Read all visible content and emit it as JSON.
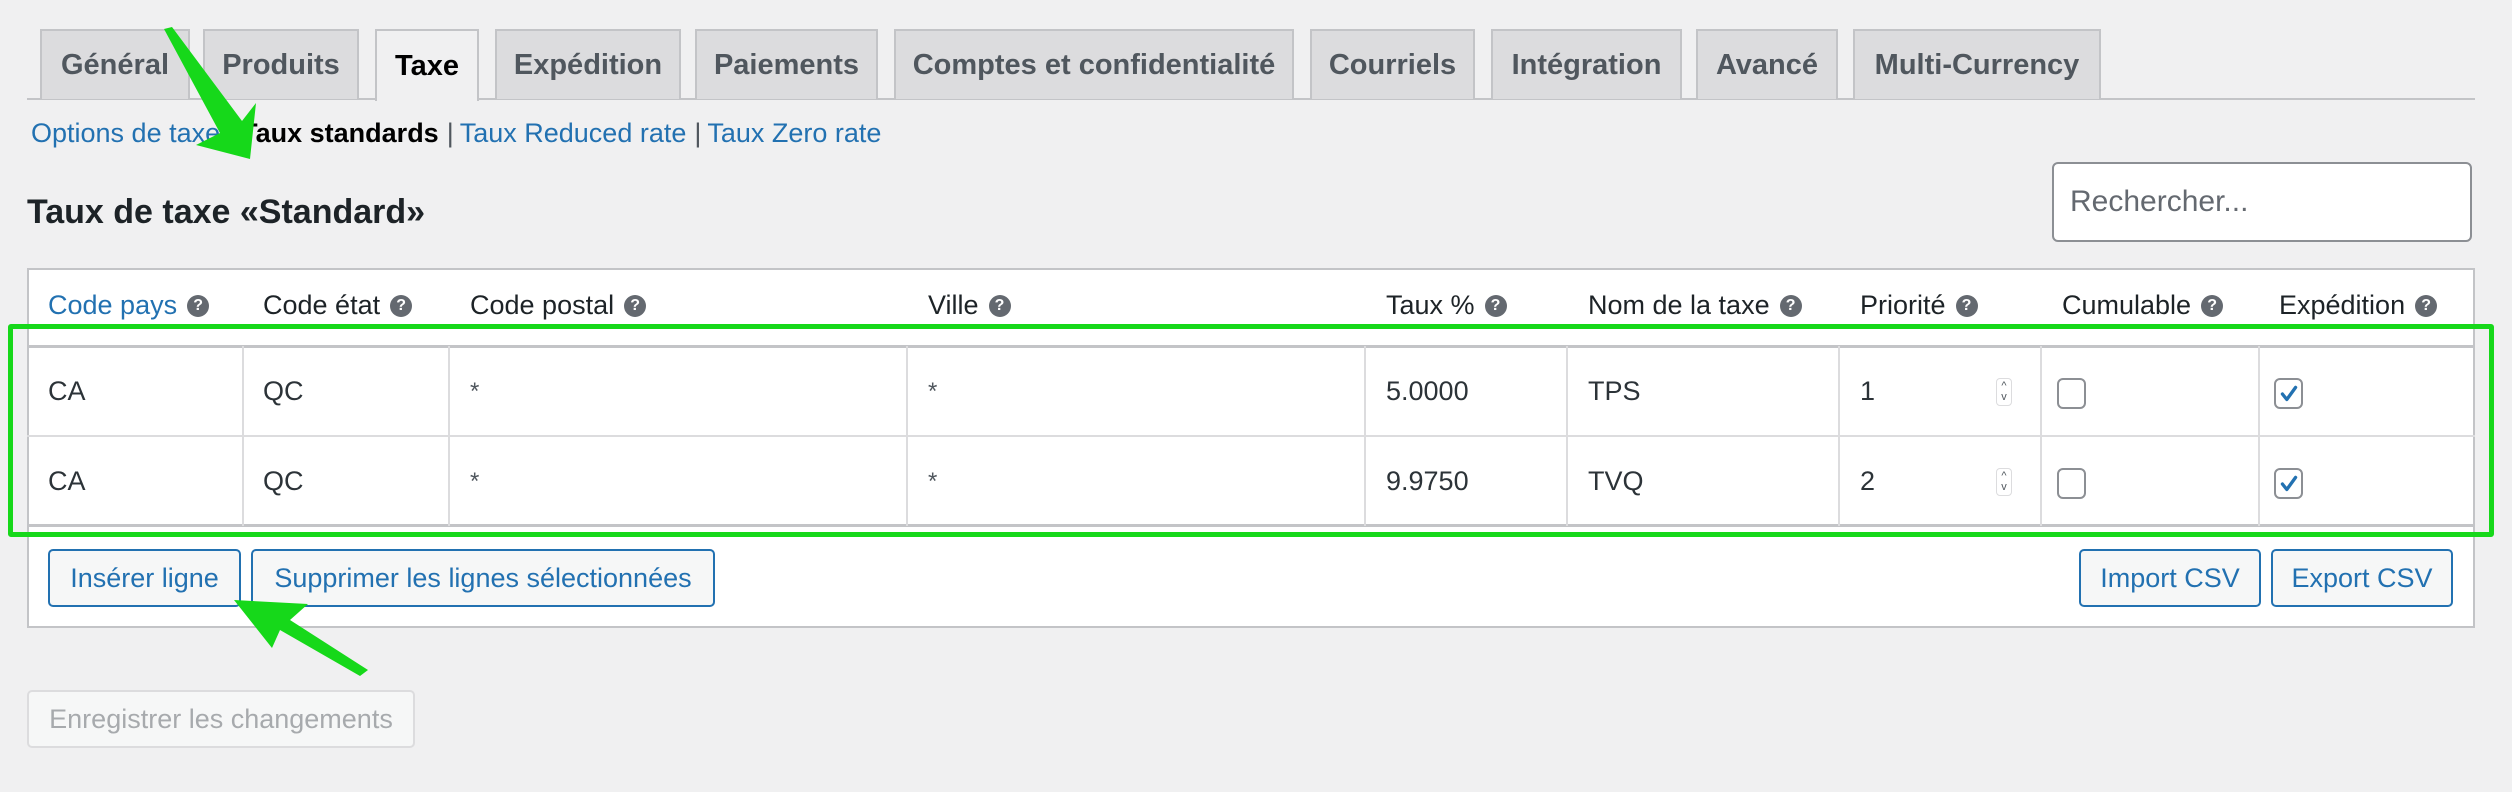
{
  "tabs": [
    {
      "label": "Général",
      "active": false
    },
    {
      "label": "Produits",
      "active": false
    },
    {
      "label": "Taxe",
      "active": true
    },
    {
      "label": "Expédition",
      "active": false
    },
    {
      "label": "Paiements",
      "active": false
    },
    {
      "label": "Comptes et confidentialité",
      "active": false
    },
    {
      "label": "Courriels",
      "active": false
    },
    {
      "label": "Intégration",
      "active": false
    },
    {
      "label": "Avancé",
      "active": false
    },
    {
      "label": "Multi-Currency",
      "active": false
    }
  ],
  "sublinks": {
    "options": "Options de taxe",
    "standard": "Taux standards",
    "reduced": "Taux Reduced rate",
    "zero": "Taux Zero rate",
    "separator": "|"
  },
  "heading": "Taux de taxe «Standard»",
  "search": {
    "placeholder": "Rechercher...",
    "value": ""
  },
  "table": {
    "help_glyph": "?",
    "columns": [
      {
        "label": "Code pays",
        "sortable": true
      },
      {
        "label": "Code état"
      },
      {
        "label": "Code postal"
      },
      {
        "label": "Ville"
      },
      {
        "label": "Taux %"
      },
      {
        "label": "Nom de la taxe"
      },
      {
        "label": "Priorité"
      },
      {
        "label": "Cumulable"
      },
      {
        "label": "Expédition"
      }
    ],
    "rows": [
      {
        "country": "CA",
        "state": "QC",
        "postcode": "*",
        "city": "*",
        "rate": "5.0000",
        "name": "TPS",
        "priority": "1",
        "compound": false,
        "shipping": true
      },
      {
        "country": "CA",
        "state": "QC",
        "postcode": "*",
        "city": "*",
        "rate": "9.9750",
        "name": "TVQ",
        "priority": "2",
        "compound": false,
        "shipping": true
      }
    ]
  },
  "buttons": {
    "insert": "Insérer ligne",
    "remove": "Supprimer les lignes sélectionnées",
    "import": "Import CSV",
    "export": "Export CSV",
    "save": "Enregistrer les changements"
  },
  "spinner_glyphs": {
    "up": "^",
    "down": "v"
  },
  "colors": {
    "link": "#2271b1",
    "annotation": "#16d81a",
    "checkbox_check": "#2271b1"
  }
}
